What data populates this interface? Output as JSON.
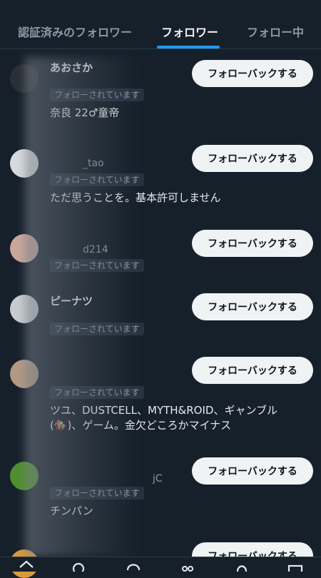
{
  "tabs": [
    {
      "label": "認証済みのフォロワー"
    },
    {
      "label": "フォロワー"
    },
    {
      "label": "フォロー中"
    }
  ],
  "followers": [
    {
      "name": "あおさか",
      "handle": "",
      "badge": "フォローされています",
      "bio": "奈良 22♂童帝",
      "button": "フォローバックする"
    },
    {
      "name": "",
      "handle": "_tao",
      "badge": "フォローされています",
      "bio": "ただ思うことを。基本許可しません",
      "button": "フォローバックする"
    },
    {
      "name": "",
      "handle": "d214",
      "badge": "フォローされています",
      "bio": "",
      "button": "フォローバックする"
    },
    {
      "name": "ピーナツ",
      "handle": "",
      "badge": "フォローされています",
      "bio": "",
      "button": "フォローバックする"
    },
    {
      "name": "",
      "handle": "",
      "badge": "フォローされています",
      "bio": "ツユ、DUSTCELL、MYTH&ROID、ギャンブル(🏇)、ゲーム。金欠どころかマイナス",
      "button": "フォローバックする"
    },
    {
      "name": "",
      "handle": "jC",
      "badge": "フォローされています",
      "bio": "チンパン",
      "button": "フォローバックする"
    },
    {
      "name": "",
      "handle": "",
      "badge": "",
      "bio": "",
      "button": "フォローバックする"
    }
  ],
  "nav": [
    {
      "icon": "home-icon"
    },
    {
      "icon": "search-icon"
    },
    {
      "icon": "spaces-icon"
    },
    {
      "icon": "communities-icon"
    },
    {
      "icon": "notifications-icon"
    },
    {
      "icon": "messages-icon"
    }
  ],
  "colors": {
    "background": "#15202b",
    "accent": "#1d9bf0",
    "button_bg": "#eff3f4"
  }
}
